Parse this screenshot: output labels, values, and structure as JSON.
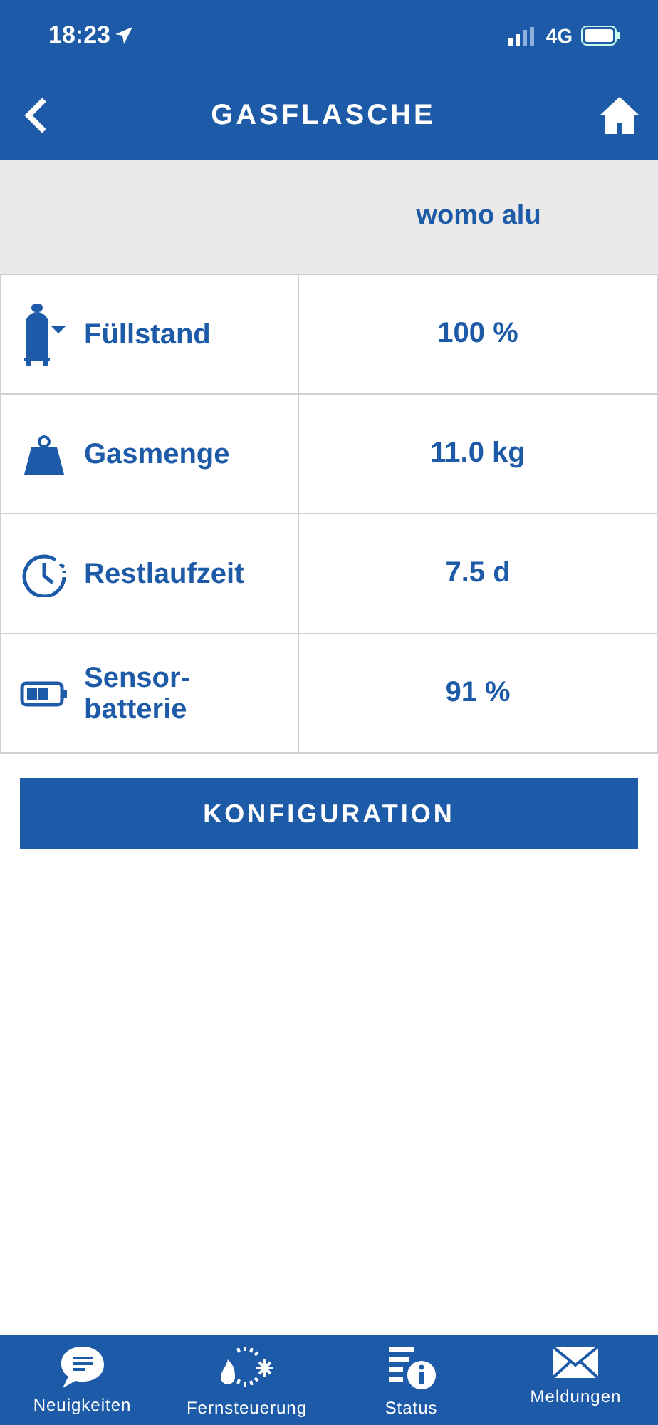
{
  "status_bar": {
    "time": "18:23",
    "network": "4G"
  },
  "header": {
    "title": "GASFLASCHE"
  },
  "device": {
    "name": "womo alu"
  },
  "rows": [
    {
      "kind": "bottle",
      "label": "Füllstand",
      "value": "100 %"
    },
    {
      "kind": "weight",
      "label": "Gasmenge",
      "value": "11.0 kg"
    },
    {
      "kind": "clock",
      "label": "Restlaufzeit",
      "value": "7.5 d"
    },
    {
      "kind": "battery",
      "label": "Sensor-\nbatterie",
      "value": "91 %"
    }
  ],
  "button": {
    "label": "KONFIGURATION"
  },
  "tab_bar": [
    {
      "kind": "chat",
      "label": "Neuigkeiten"
    },
    {
      "kind": "remote",
      "label": "Fernsteuerung"
    },
    {
      "kind": "status",
      "label": "Status"
    },
    {
      "kind": "mail",
      "label": "Meldungen"
    }
  ]
}
